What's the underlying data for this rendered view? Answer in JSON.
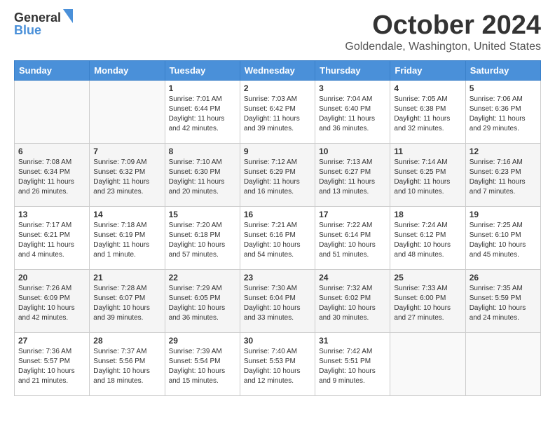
{
  "logo": {
    "general": "General",
    "blue": "Blue"
  },
  "title": "October 2024",
  "location": "Goldendale, Washington, United States",
  "days_of_week": [
    "Sunday",
    "Monday",
    "Tuesday",
    "Wednesday",
    "Thursday",
    "Friday",
    "Saturday"
  ],
  "weeks": [
    [
      {
        "day": "",
        "info": ""
      },
      {
        "day": "",
        "info": ""
      },
      {
        "day": "1",
        "info": "Sunrise: 7:01 AM\nSunset: 6:44 PM\nDaylight: 11 hours and 42 minutes."
      },
      {
        "day": "2",
        "info": "Sunrise: 7:03 AM\nSunset: 6:42 PM\nDaylight: 11 hours and 39 minutes."
      },
      {
        "day": "3",
        "info": "Sunrise: 7:04 AM\nSunset: 6:40 PM\nDaylight: 11 hours and 36 minutes."
      },
      {
        "day": "4",
        "info": "Sunrise: 7:05 AM\nSunset: 6:38 PM\nDaylight: 11 hours and 32 minutes."
      },
      {
        "day": "5",
        "info": "Sunrise: 7:06 AM\nSunset: 6:36 PM\nDaylight: 11 hours and 29 minutes."
      }
    ],
    [
      {
        "day": "6",
        "info": "Sunrise: 7:08 AM\nSunset: 6:34 PM\nDaylight: 11 hours and 26 minutes."
      },
      {
        "day": "7",
        "info": "Sunrise: 7:09 AM\nSunset: 6:32 PM\nDaylight: 11 hours and 23 minutes."
      },
      {
        "day": "8",
        "info": "Sunrise: 7:10 AM\nSunset: 6:30 PM\nDaylight: 11 hours and 20 minutes."
      },
      {
        "day": "9",
        "info": "Sunrise: 7:12 AM\nSunset: 6:29 PM\nDaylight: 11 hours and 16 minutes."
      },
      {
        "day": "10",
        "info": "Sunrise: 7:13 AM\nSunset: 6:27 PM\nDaylight: 11 hours and 13 minutes."
      },
      {
        "day": "11",
        "info": "Sunrise: 7:14 AM\nSunset: 6:25 PM\nDaylight: 11 hours and 10 minutes."
      },
      {
        "day": "12",
        "info": "Sunrise: 7:16 AM\nSunset: 6:23 PM\nDaylight: 11 hours and 7 minutes."
      }
    ],
    [
      {
        "day": "13",
        "info": "Sunrise: 7:17 AM\nSunset: 6:21 PM\nDaylight: 11 hours and 4 minutes."
      },
      {
        "day": "14",
        "info": "Sunrise: 7:18 AM\nSunset: 6:19 PM\nDaylight: 11 hours and 1 minute."
      },
      {
        "day": "15",
        "info": "Sunrise: 7:20 AM\nSunset: 6:18 PM\nDaylight: 10 hours and 57 minutes."
      },
      {
        "day": "16",
        "info": "Sunrise: 7:21 AM\nSunset: 6:16 PM\nDaylight: 10 hours and 54 minutes."
      },
      {
        "day": "17",
        "info": "Sunrise: 7:22 AM\nSunset: 6:14 PM\nDaylight: 10 hours and 51 minutes."
      },
      {
        "day": "18",
        "info": "Sunrise: 7:24 AM\nSunset: 6:12 PM\nDaylight: 10 hours and 48 minutes."
      },
      {
        "day": "19",
        "info": "Sunrise: 7:25 AM\nSunset: 6:10 PM\nDaylight: 10 hours and 45 minutes."
      }
    ],
    [
      {
        "day": "20",
        "info": "Sunrise: 7:26 AM\nSunset: 6:09 PM\nDaylight: 10 hours and 42 minutes."
      },
      {
        "day": "21",
        "info": "Sunrise: 7:28 AM\nSunset: 6:07 PM\nDaylight: 10 hours and 39 minutes."
      },
      {
        "day": "22",
        "info": "Sunrise: 7:29 AM\nSunset: 6:05 PM\nDaylight: 10 hours and 36 minutes."
      },
      {
        "day": "23",
        "info": "Sunrise: 7:30 AM\nSunset: 6:04 PM\nDaylight: 10 hours and 33 minutes."
      },
      {
        "day": "24",
        "info": "Sunrise: 7:32 AM\nSunset: 6:02 PM\nDaylight: 10 hours and 30 minutes."
      },
      {
        "day": "25",
        "info": "Sunrise: 7:33 AM\nSunset: 6:00 PM\nDaylight: 10 hours and 27 minutes."
      },
      {
        "day": "26",
        "info": "Sunrise: 7:35 AM\nSunset: 5:59 PM\nDaylight: 10 hours and 24 minutes."
      }
    ],
    [
      {
        "day": "27",
        "info": "Sunrise: 7:36 AM\nSunset: 5:57 PM\nDaylight: 10 hours and 21 minutes."
      },
      {
        "day": "28",
        "info": "Sunrise: 7:37 AM\nSunset: 5:56 PM\nDaylight: 10 hours and 18 minutes."
      },
      {
        "day": "29",
        "info": "Sunrise: 7:39 AM\nSunset: 5:54 PM\nDaylight: 10 hours and 15 minutes."
      },
      {
        "day": "30",
        "info": "Sunrise: 7:40 AM\nSunset: 5:53 PM\nDaylight: 10 hours and 12 minutes."
      },
      {
        "day": "31",
        "info": "Sunrise: 7:42 AM\nSunset: 5:51 PM\nDaylight: 10 hours and 9 minutes."
      },
      {
        "day": "",
        "info": ""
      },
      {
        "day": "",
        "info": ""
      }
    ]
  ]
}
